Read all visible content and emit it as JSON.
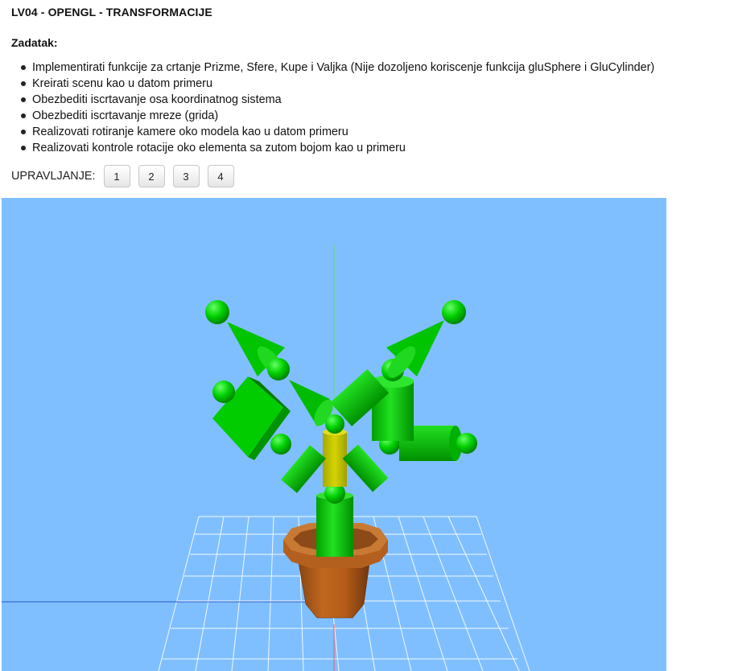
{
  "page": {
    "title": "LV04 - OPENGL - TRANSFORMACIJE"
  },
  "task": {
    "heading": "Zadatak:",
    "items": [
      "Implementirati funkcije za crtanje Prizme, Sfere, Kupe i Valjka (Nije dozoljeno koriscenje funkcija gluSphere i GluCylinder)",
      "Kreirati scenu kao u datom primeru",
      "Obezbediti iscrtavanje osa koordinatnog sistema",
      "Obezbediti iscrtavanje mreze (grida)",
      "Realizovati rotiranje kamere oko modela kao u datom primeru",
      "Realizovati kontrole rotacije oko elementa sa zutom bojom kao u primeru"
    ]
  },
  "controls": {
    "label": "UPRAVLJANJE:",
    "buttons": [
      "1",
      "2",
      "3",
      "4"
    ]
  },
  "scene": {
    "background": "#80bfff",
    "grid_color": "#ffffff",
    "colors": {
      "plant": "#00cc00",
      "plant_dark": "#009900",
      "plant_light": "#22dd22",
      "selected_element": "#c8c800",
      "pot": "#b35c1e",
      "pot_dark": "#7a3a10",
      "axis_x": "#ff4444",
      "axis_y": "#66dd66",
      "axis_z": "#2255cc"
    }
  }
}
